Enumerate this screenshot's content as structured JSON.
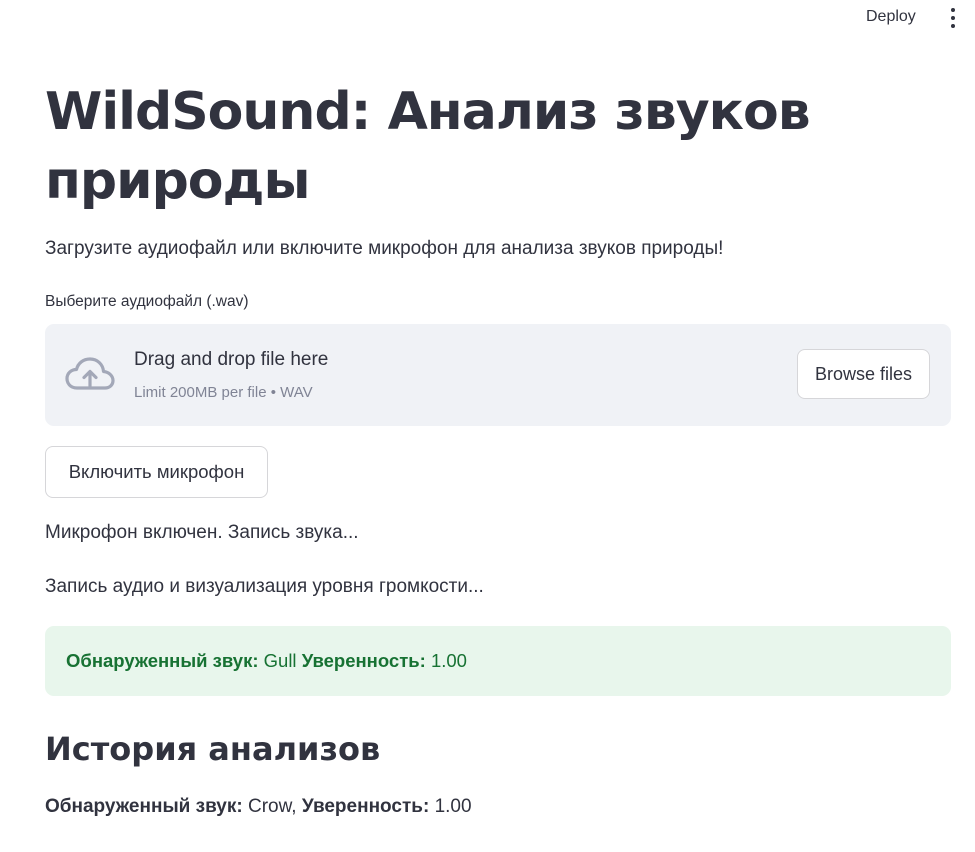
{
  "topbar": {
    "deploy_label": "Deploy",
    "menu_icon": "kebab-menu-icon"
  },
  "page": {
    "title": "WildSound: Анализ звуков природы",
    "intro": "Загрузите аудиофайл или включите микрофон для анализа звуков природы!"
  },
  "uploader": {
    "label": "Выберите аудиофайл (.wav)",
    "drag_text": "Drag and drop file here",
    "limit_text": "Limit 200MB per file • WAV",
    "browse_label": "Browse files",
    "icon": "cloud-upload-icon"
  },
  "mic": {
    "button_label": "Включить микрофон",
    "status_on": "Микрофон включен. Запись звука...",
    "status_recording": "Запись аудио и визуализация уровня громкости..."
  },
  "result": {
    "sound_label": "Обнаруженный звук:",
    "sound_value": "Gull",
    "confidence_label": "Уверенность:",
    "confidence_value": "1.00"
  },
  "history": {
    "heading": "История анализов",
    "items": [
      {
        "sound_label": "Обнаруженный звук:",
        "sound_value": "Crow",
        "separator": ",",
        "confidence_label": "Уверенность:",
        "confidence_value": "1.00"
      }
    ]
  },
  "colors": {
    "text": "#31333f",
    "muted": "#808495",
    "dropzone_bg": "#f0f2f6",
    "success_bg": "#e8f6ec",
    "success_text": "#177233"
  }
}
